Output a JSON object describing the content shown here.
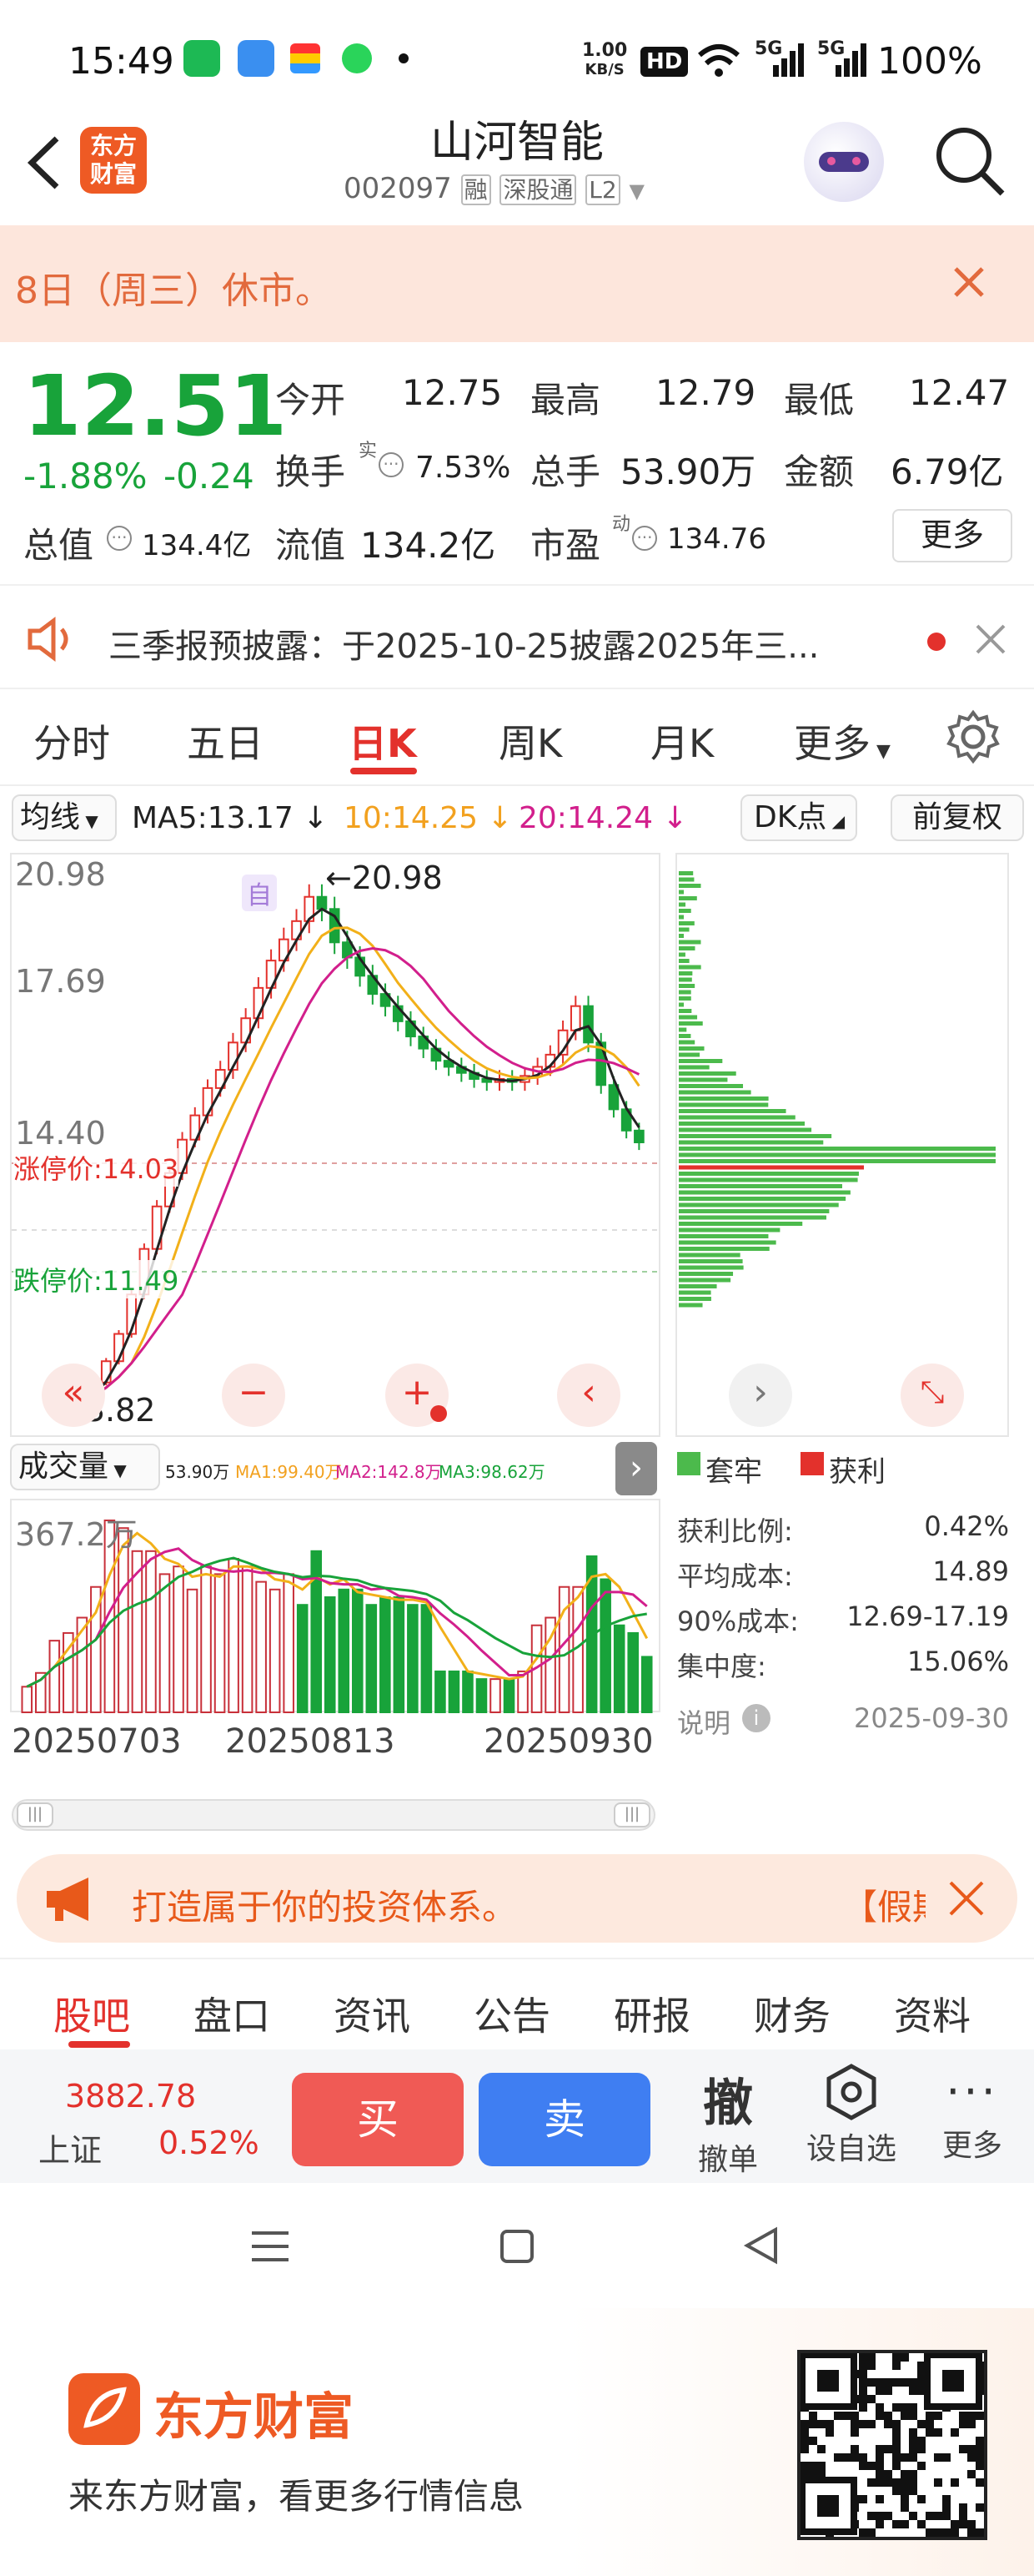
{
  "status": {
    "time": "15:49",
    "net_speed_top": "1.00",
    "net_speed_unit": "KB/S",
    "hd": "HD",
    "signal1": "5G",
    "signal2": "5G",
    "battery": "100%"
  },
  "header": {
    "logo_line1": "东方",
    "logo_line2": "财富",
    "stock_name": "山河智能",
    "code": "002097",
    "tag1": "融",
    "tag2": "深股通",
    "tag3": "L2"
  },
  "banner": {
    "text": "8日（周三）休市。"
  },
  "quote": {
    "price": "12.51",
    "change_pct": "-1.88%",
    "change": "-0.24",
    "open_label": "今开",
    "open": "12.75",
    "high_label": "最高",
    "high": "12.79",
    "low_label": "最低",
    "low": "12.47",
    "turnover_label": "换手",
    "turnover_sup": "实",
    "turnover": "7.53%",
    "volume_label": "总手",
    "volume": "53.90万",
    "amount_label": "金额",
    "amount": "6.79亿",
    "mktcap_label": "总值",
    "mktcap": "134.4亿",
    "float_label": "流值",
    "float": "134.2亿",
    "pe_label": "市盈",
    "pe_sup": "动",
    "pe": "134.76",
    "more": "更多"
  },
  "notice": {
    "text": "三季报预披露：于2025-10-25披露2025年三..."
  },
  "chart_tabs": [
    "分时",
    "五日",
    "日K",
    "周K",
    "月K",
    "更多"
  ],
  "ma_bar": {
    "mode": "均线",
    "ma5": "MA5:13.17",
    "ma10": "10:14.25",
    "ma20": "20:14.24",
    "dk": "DK点",
    "adjust": "前复权"
  },
  "kline_labels": {
    "high": "20.98",
    "high_marker": "20.98",
    "mid": "17.69",
    "low": "14.40",
    "limit_up": "涨停价:14.03",
    "limit_down": "跌停价:11.49",
    "bottom": "3.82",
    "self": "自"
  },
  "volume_bar": {
    "label": "成交量",
    "v": "53.90万",
    "ma1": "MA1:99.40万",
    "ma2": "MA2:142.8万",
    "ma3": "MA3:98.62万",
    "max": "367.2万"
  },
  "dates": [
    "20250703",
    "20250813",
    "20250930"
  ],
  "chip": {
    "legend1": "套牢",
    "legend2": "获利",
    "profit_label": "获利比例:",
    "profit": "0.42%",
    "avg_label": "平均成本:",
    "avg": "14.89",
    "c90_label": "90%成本:",
    "c90": "12.69-17.19",
    "conc_label": "集中度:",
    "conc": "15.06%",
    "note_label": "说明",
    "date": "2025-09-30"
  },
  "ad": {
    "text": "打造属于你的投资体系。",
    "tail": "【假期"
  },
  "bottom_tabs": [
    "股吧",
    "盘口",
    "资讯",
    "公告",
    "研报",
    "财务",
    "资料"
  ],
  "toolbar": {
    "index_value": "3882.78",
    "index_name": "上证",
    "index_pct": "0.52%",
    "buy": "买",
    "sell": "卖",
    "cancel_big": "撤",
    "cancel": "撤单",
    "watch": "设自选",
    "more": "更多"
  },
  "footer": {
    "brand": "东方财富",
    "slogan": "来东方财富，看更多行情信息"
  },
  "chart_data": {
    "type": "candlestick",
    "x_ticks": [
      "20250703",
      "20250813",
      "20250930"
    ],
    "y_ticks": [
      20.98,
      17.69,
      14.4
    ],
    "ohlc_close_sample": [
      3.82,
      4.0,
      4.6,
      5.3,
      6.2,
      7.5,
      9.0,
      10.4,
      11.5,
      12.6,
      13.4,
      14.3,
      14.9,
      15.8,
      16.6,
      17.6,
      18.5,
      19.2,
      19.8,
      20.6,
      20.2,
      19.1,
      18.6,
      18.0,
      17.4,
      17.0,
      16.5,
      16.0,
      15.6,
      15.2,
      15.0,
      14.8,
      14.6,
      14.5,
      14.6,
      14.5,
      14.7,
      15.0,
      15.4,
      16.2,
      17.0,
      15.8,
      14.4,
      13.6,
      12.9,
      12.51
    ]
  }
}
